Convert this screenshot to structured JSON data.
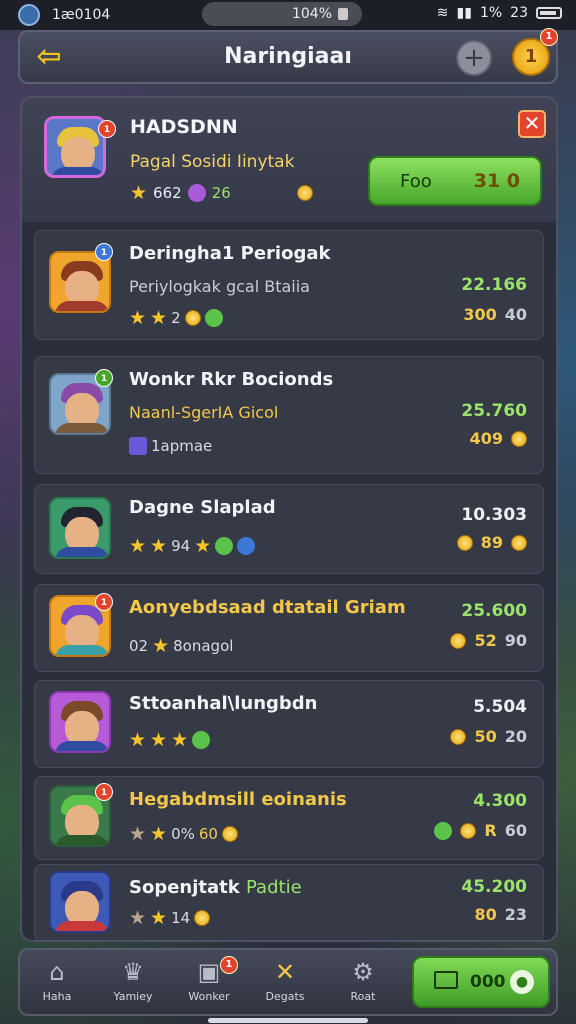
{
  "status_bar": {
    "time_left": "1æ0104",
    "center": "104%",
    "battery": "1%",
    "time_right": "23"
  },
  "header": {
    "title": "Naringiaaı"
  },
  "featured": {
    "name": "HADSDNN",
    "subtitle": "Pagal Sosidi Iinytak",
    "stat1": "662",
    "stat2": "26",
    "button_label": "Foo",
    "button_value": "31 0"
  },
  "rows": [
    {
      "name": "Deringha1 Periogak",
      "subtitle": "Periylogkak gcal Btaiia",
      "meta": "2",
      "score": "22.166",
      "reward": "300",
      "reward_extra": "40"
    },
    {
      "name": "Wonkr Rkr Bocionds",
      "subtitle": "Naanl-SgerIA Gicol",
      "meta": "1apmae",
      "score": "25.760",
      "reward": "409",
      "reward_extra": ""
    },
    {
      "name": "Dagne Slaplad",
      "subtitle": "",
      "meta": "94",
      "score": "10.303",
      "reward": "89",
      "reward_extra": ""
    },
    {
      "name": "Aonyebdsaad dtatail Griam",
      "subtitle": "",
      "meta": "02",
      "meta2": "8onagol",
      "score": "25.600",
      "reward": "52",
      "reward_extra": "90"
    },
    {
      "name": "Sttoanhal\\lungbdn",
      "subtitle": "",
      "meta": "",
      "score": "5.504",
      "reward": "50",
      "reward_extra": "20"
    },
    {
      "name": "Hegabdmsill eoinanis",
      "subtitle": "",
      "meta": "0%",
      "meta2": "60",
      "score": "4.300",
      "reward": "R",
      "reward_extra": "60"
    },
    {
      "name": "Sopenjtatk",
      "name_accent": "Padtie",
      "subtitle": "",
      "meta": "14",
      "score": "45.200",
      "reward": "80",
      "reward_extra": "23"
    }
  ],
  "bottom_nav": {
    "items": [
      "Haha",
      "Yamiey",
      "Wonker",
      "Degats",
      "Roat"
    ],
    "cta_label": "000",
    "notif": "1"
  },
  "colors": {
    "accent_green": "#47a72b",
    "gold": "#f3c84a",
    "score_green": "#9be36b",
    "close_red": "#e2452b"
  }
}
